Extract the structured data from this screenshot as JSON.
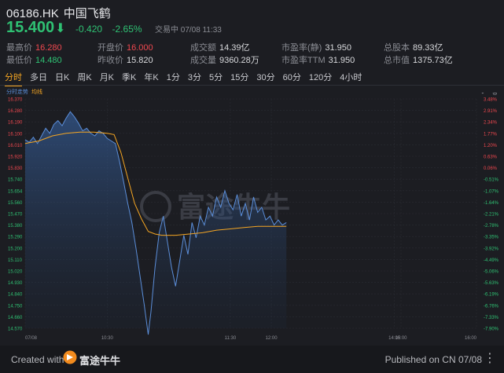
{
  "stock": {
    "code": "06186.HK",
    "name": "中国飞鹤",
    "price": "15.400",
    "change": "-0.420",
    "change_pct": "-2.65%",
    "status": "交易中 07/08 11:33"
  },
  "stats": [
    {
      "label": "最高价",
      "value": "16.280",
      "color": "red"
    },
    {
      "label": "最低价",
      "value": "14.480",
      "color": "green"
    },
    {
      "label": "开盘价",
      "value": "16.000",
      "color": "red"
    },
    {
      "label": "昨收价",
      "value": "15.820",
      "color": ""
    },
    {
      "label": "成交额",
      "value": "14.39亿",
      "color": ""
    },
    {
      "label": "成交量",
      "value": "9360.28万",
      "color": ""
    },
    {
      "label": "市盈率(静)",
      "value": "31.950",
      "color": ""
    },
    {
      "label": "市盈率TTM",
      "value": "31.950",
      "color": ""
    },
    {
      "label": "总股本",
      "value": "89.33亿",
      "color": ""
    },
    {
      "label": "总市值",
      "value": "1375.73亿",
      "color": ""
    }
  ],
  "tabs": [
    "分时",
    "多日",
    "日K",
    "周K",
    "月K",
    "季K",
    "年K",
    "1分",
    "3分",
    "5分",
    "15分",
    "30分",
    "60分",
    "120分",
    "4小时"
  ],
  "active_tab": "分时",
  "legend": {
    "price": "分时走势",
    "avg": "均线"
  },
  "watermark": "富途牛牛",
  "chart_data": {
    "type": "line",
    "x_ticks": [
      "07/08",
      "10:30",
      "11:30",
      "12:00",
      "14:00",
      "15:00",
      "16:00"
    ],
    "y_ticks": [
      "16.370",
      "16.280",
      "16.190",
      "16.100",
      "16.010",
      "15.920",
      "15.830",
      "15.740",
      "15.654",
      "15.560",
      "15.470",
      "15.380",
      "15.290",
      "15.200",
      "15.110",
      "15.020",
      "14.930",
      "14.840",
      "14.750",
      "14.660",
      "14.570"
    ],
    "pct_ticks": [
      "3.48%",
      "2.91%",
      "2.34%",
      "1.77%",
      "1.20%",
      "0.63%",
      "0.06%",
      "-0.51%",
      "-1.07%",
      "-1.64%",
      "-2.21%",
      "-2.78%",
      "-3.35%",
      "-3.92%",
      "-4.49%",
      "-5.06%",
      "-5.63%",
      "-6.19%",
      "-6.76%",
      "-7.33%",
      "-7.90%"
    ],
    "ylim": [
      14.57,
      16.37
    ],
    "x_minutes_range": [
      0,
      330
    ],
    "series": [
      {
        "name": "分时走势",
        "values": [
          [
            0,
            16.05
          ],
          [
            3,
            16.03
          ],
          [
            6,
            16.07
          ],
          [
            9,
            16.02
          ],
          [
            12,
            16.08
          ],
          [
            15,
            16.14
          ],
          [
            18,
            16.1
          ],
          [
            21,
            16.17
          ],
          [
            24,
            16.2
          ],
          [
            27,
            16.16
          ],
          [
            30,
            16.22
          ],
          [
            33,
            16.27
          ],
          [
            36,
            16.23
          ],
          [
            39,
            16.18
          ],
          [
            42,
            16.12
          ],
          [
            45,
            16.14
          ],
          [
            48,
            16.1
          ],
          [
            51,
            16.08
          ],
          [
            54,
            16.12
          ],
          [
            57,
            16.1
          ],
          [
            60,
            16.06
          ],
          [
            63,
            16.04
          ],
          [
            66,
            16.02
          ],
          [
            69,
            15.88
          ],
          [
            72,
            15.72
          ],
          [
            75,
            15.55
          ],
          [
            78,
            15.4
          ],
          [
            81,
            15.2
          ],
          [
            84,
            14.98
          ],
          [
            87,
            14.76
          ],
          [
            90,
            14.52
          ],
          [
            92,
            14.7
          ],
          [
            95,
            15.05
          ],
          [
            98,
            15.32
          ],
          [
            101,
            15.45
          ],
          [
            104,
            15.25
          ],
          [
            107,
            15.05
          ],
          [
            110,
            14.9
          ],
          [
            113,
            15.1
          ],
          [
            116,
            15.3
          ],
          [
            119,
            15.15
          ],
          [
            122,
            15.4
          ],
          [
            125,
            15.28
          ],
          [
            128,
            15.45
          ],
          [
            131,
            15.38
          ],
          [
            134,
            15.52
          ],
          [
            137,
            15.45
          ],
          [
            140,
            15.6
          ],
          [
            143,
            15.52
          ],
          [
            146,
            15.65
          ],
          [
            149,
            15.55
          ],
          [
            152,
            15.5
          ],
          [
            155,
            15.62
          ],
          [
            158,
            15.45
          ],
          [
            161,
            15.55
          ],
          [
            164,
            15.42
          ],
          [
            167,
            15.6
          ],
          [
            170,
            15.48
          ],
          [
            173,
            15.52
          ],
          [
            176,
            15.42
          ],
          [
            179,
            15.45
          ],
          [
            182,
            15.38
          ],
          [
            185,
            15.42
          ],
          [
            188,
            15.38
          ],
          [
            191,
            15.4
          ]
        ]
      },
      {
        "name": "均线",
        "values": [
          [
            0,
            16.02
          ],
          [
            10,
            16.04
          ],
          [
            20,
            16.08
          ],
          [
            30,
            16.1
          ],
          [
            40,
            16.11
          ],
          [
            50,
            16.11
          ],
          [
            60,
            16.1
          ],
          [
            65,
            16.09
          ],
          [
            70,
            15.95
          ],
          [
            75,
            15.75
          ],
          [
            80,
            15.55
          ],
          [
            85,
            15.43
          ],
          [
            90,
            15.33
          ],
          [
            95,
            15.31
          ],
          [
            100,
            15.3
          ],
          [
            110,
            15.3
          ],
          [
            120,
            15.31
          ],
          [
            130,
            15.32
          ],
          [
            140,
            15.34
          ],
          [
            150,
            15.35
          ],
          [
            160,
            15.36
          ],
          [
            170,
            15.37
          ],
          [
            180,
            15.37
          ],
          [
            191,
            15.37
          ]
        ]
      }
    ],
    "colors": {
      "price": "#5b8ed9",
      "avg": "#f5a623"
    }
  },
  "footer": {
    "created": "Created with",
    "brand": "富途牛牛",
    "published": "Published on CN 07/08"
  }
}
